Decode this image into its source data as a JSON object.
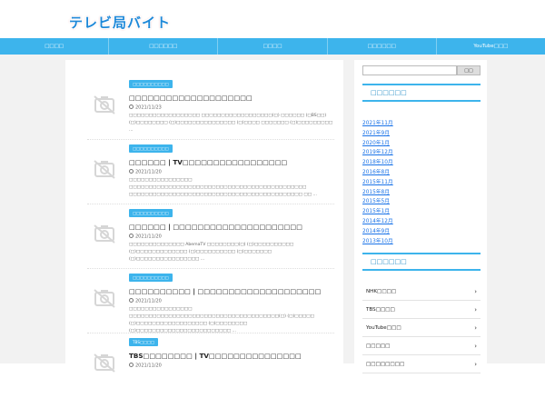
{
  "site": {
    "logo": "テレビ局バイト"
  },
  "nav": [
    {
      "label": "□□□□"
    },
    {
      "label": "□□□□□□"
    },
    {
      "label": "□□□□"
    },
    {
      "label": "□□□□□□"
    },
    {
      "label": "YouTube□□□"
    }
  ],
  "articles": [
    {
      "category": "□□□□□□□□□□",
      "title": "□□□□□□□□□□□□□□□□□□□□",
      "date": "2021/11/23",
      "excerpt": "□□□□□□□□□□□□□□□□□□ □□□□□□□□□□□□□□□□□□(□) □□□□□□ (□BS□□) (□)□□□□□□□□ (□)□□□□□□□□□□□□□□□ (□)□□□□ □□□□□□□ (□)□□□□□□□□□ ..."
    },
    {
      "category": "□□□□□□□□□□",
      "title": "□□□□□□ | TV□□□□□□□□□□□□□□□□□",
      "date": "2021/11/20",
      "excerpt": "□□□□□□□□□□□□□□□□ □□□□□□□□□□□□□□□□□□□□□□□□□□□□□□□□□□□□□□□□□□□□□ □□□□□□□□□□□□□□□□□□□□□□□□□□□□□□□□□□□□□□□□□□□□ □□ ..."
    },
    {
      "category": "□□□□□□□□□□",
      "title": "□□□□□□ | □□□□□□□□□□□□□□□□□□□□□",
      "date": "2021/11/20",
      "excerpt": "□□□□□□□□□□□□□□ AbemaTV □□□□□□□□(□) (□)□□□□□□□□□□ (□)□□□□□□□□□□□□□ (□)□□□□□□□□□□ (□)□□□□□□□ (□)□□□□□□□□□□□□□□□□ ..."
    },
    {
      "category": "□□□□□□□□□□",
      "title": "□□□□□□□□□□ | □□□□□□□□□□□□□□□□□□□□",
      "date": "2021/11/20",
      "excerpt": "□□□□□□□□□□□□□□□□ □□□□□□□□□□□□□□□□□□□□□□□□□□□□□□□□□□□□□□(□) (□)□□□□□ (□)□□□□□□□□□□□□□□□□□□ (□)□□□□□□□□ (□)□□□□□□□□□□□□□□□□□□□□□□□□ ..."
    },
    {
      "category": "TBS□□□□",
      "title": "TBS□□□□□□□□ | TV□□□□□□□□□□□□□□□",
      "date": "2021/11/20",
      "excerpt": ""
    }
  ],
  "sidebar": {
    "search_placeholder": "",
    "search_button": "□□",
    "archive_title": "□□□□□□",
    "archives": [
      "2021年11月",
      "2021年9月",
      "2020年1月",
      "2019年12月",
      "2018年10月",
      "2016年8月",
      "2015年11月",
      "2015年8月",
      "2015年5月",
      "2015年1月",
      "2014年12月",
      "2014年9月",
      "2013年10月"
    ],
    "category_title": "□□□□□□",
    "categories": [
      "NHK□□□□",
      "TBS□□□□",
      "YouTube□□□",
      "□□□□□",
      "□□□□□□□□"
    ]
  }
}
